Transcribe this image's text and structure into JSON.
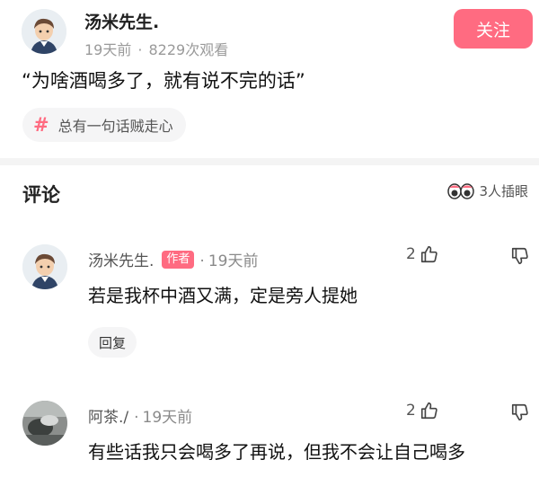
{
  "post": {
    "author_name": "汤米先生.",
    "time": "19天前",
    "views": "8229次观看",
    "follow_label": "关注",
    "quote": "“为啥酒喝多了，就有说不完的话”",
    "topic": "总有一句话贼走心",
    "accent_color": "#ff6b81"
  },
  "comments_section": {
    "title": "评论",
    "peek_count": "3人插眼"
  },
  "comments": [
    {
      "author": "汤米先生.",
      "author_tag": "作者",
      "time": "19天前",
      "likes": "2",
      "text": "若是我杯中酒又满，定是旁人提她",
      "reply_label": "回复"
    },
    {
      "author": "阿茶./",
      "time": "19天前",
      "likes": "2",
      "text": "有些话我只会喝多了再说，但我不会让自己喝多"
    }
  ]
}
